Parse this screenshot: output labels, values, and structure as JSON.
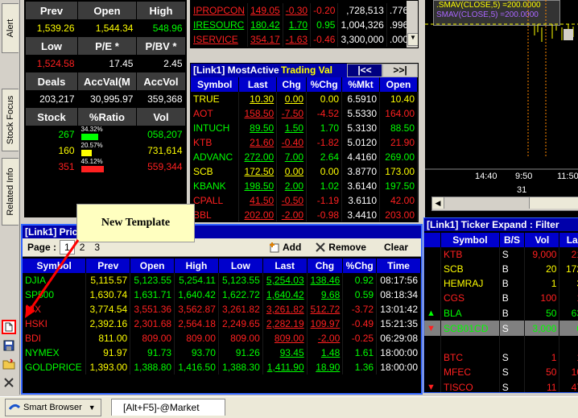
{
  "side_tabs": [
    "Alert",
    "Stock Focus",
    "Related Info"
  ],
  "side_icons": [
    "new-template-icon",
    "save-icon",
    "folder-icon",
    "close-icon"
  ],
  "stats": {
    "h1": [
      "Prev",
      "Open",
      "High"
    ],
    "r1": [
      "1,539.26",
      "1,544.34",
      "548.96"
    ],
    "h2": [
      "Low",
      "P/E *",
      "P/BV *"
    ],
    "r2": [
      "1,524.58",
      "17.45",
      "2.45"
    ],
    "h3": [
      "Deals",
      "AccVal(M",
      "AccVol"
    ],
    "r3": [
      "203,217",
      "30,995.97",
      "359,368"
    ],
    "h4": [
      "Stock",
      "%Ratio",
      "Vol"
    ],
    "ratio_rows": [
      {
        "stock": "267",
        "ratio": "34.32%",
        "pct": 0.3432,
        "vol": "058,207",
        "color": "#00ff00"
      },
      {
        "stock": "160",
        "ratio": "20.57%",
        "pct": 0.2057,
        "vol": "731,614",
        "color": "#ffff00"
      },
      {
        "stock": "351",
        "ratio": "45.12%",
        "pct": 0.4512,
        "vol": "559,344",
        "color": "#ff2020"
      }
    ]
  },
  "top_strip": [
    {
      "sym": "IPROPCON",
      "last": "149.05",
      "chg": "-0.30",
      "pct": "-0.20",
      "vol": ",728,513",
      "x": ".776"
    },
    {
      "sym": "IRESOURC",
      "last": "180.42",
      "chg": "1.70",
      "pct": "0.95",
      "vol": "1,004,326",
      "x": ".996"
    },
    {
      "sym": "ISERVICE",
      "last": "354.17",
      "chg": "-1.63",
      "pct": "-0.46",
      "vol": "3,300,000",
      "x": ".000"
    }
  ],
  "most_active": {
    "title": "[Link1] MostActive",
    "overlay": "Trading Val",
    "nav_prev": "|<<",
    "nav_next": ">>|",
    "headers": [
      "Symbol",
      "Last",
      "Chg",
      "%Chg",
      "%Mkt",
      "Open"
    ],
    "rows": [
      {
        "sym": "TRUE",
        "last": "10.30",
        "chg": "0.00",
        "pct": "0.00",
        "mkt": "6.5910",
        "open": "10.40",
        "c": "y"
      },
      {
        "sym": "AOT",
        "last": "158.50",
        "chg": "-7.50",
        "pct": "-4.52",
        "mkt": "5.5330",
        "open": "164.00",
        "c": "r"
      },
      {
        "sym": "INTUCH",
        "last": "89.50",
        "chg": "1.50",
        "pct": "1.70",
        "mkt": "5.3130",
        "open": "88.50",
        "c": "g"
      },
      {
        "sym": "KTB",
        "last": "21.60",
        "chg": "-0.40",
        "pct": "-1.82",
        "mkt": "5.0120",
        "open": "21.90",
        "c": "r"
      },
      {
        "sym": "ADVANC",
        "last": "272.00",
        "chg": "7.00",
        "pct": "2.64",
        "mkt": "4.4160",
        "open": "269.00",
        "c": "g"
      },
      {
        "sym": "SCB",
        "last": "172.50",
        "chg": "0.00",
        "pct": "0.00",
        "mkt": "3.8770",
        "open": "173.00",
        "c": "y"
      },
      {
        "sym": "KBANK",
        "last": "198.50",
        "chg": "2.00",
        "pct": "1.02",
        "mkt": "3.6140",
        "open": "197.50",
        "c": "g"
      },
      {
        "sym": "CPALL",
        "last": "41.50",
        "chg": "-0.50",
        "pct": "-1.19",
        "mkt": "3.6110",
        "open": "42.00",
        "c": "r"
      },
      {
        "sym": "BBL",
        "last": "202.00",
        "chg": "-2.00",
        "pct": "-0.98",
        "mkt": "3.4410",
        "open": "203.00",
        "c": "r"
      }
    ]
  },
  "chart": {
    "legend": [
      ".SMAV(CLOSE,5)",
      "=200.0000",
      "SMAV(CLOSE,5)",
      "=200.0000"
    ],
    "times": [
      "14:40",
      "9:50",
      "11:50"
    ],
    "day_label": "31"
  },
  "price_panel": {
    "title": "[Link1] Pric",
    "page_label": "Page :",
    "pages": [
      "1",
      "2",
      "3"
    ],
    "add_label": "Add",
    "remove_label": "Remove",
    "clear_label": "Clear",
    "headers": [
      "Symbol",
      "Prev",
      "Open",
      "High",
      "Low",
      "Last",
      "Chg",
      "%Chg",
      "Time"
    ],
    "rows": [
      {
        "sym": "DJIA",
        "prev": "5,115.57",
        "open": "5,123.55",
        "high": "5,254.11",
        "low": "5,123.55",
        "last": "5,254.03",
        "chg": "138.46",
        "pct": "0.92",
        "time": "08:17:56",
        "c": "g"
      },
      {
        "sym": "SP500",
        "prev": "1,630.74",
        "open": "1,631.71",
        "high": "1,640.42",
        "low": "1,622.72",
        "last": "1,640.42",
        "chg": "9.68",
        "pct": "0.59",
        "time": "08:18:34",
        "c": "g"
      },
      {
        "sym": "NIX",
        "prev": "3,774.54",
        "open": "3,551.36",
        "high": "3,562.87",
        "low": "3,261.82",
        "last": "3,261.82",
        "chg": "512.72",
        "pct": "-3.72",
        "time": "13:01:42",
        "c": "r"
      },
      {
        "sym": "HSKI",
        "prev": "2,392.16",
        "open": "2,301.68",
        "high": "2,564.18",
        "low": "2,249.65",
        "last": "2,282.19",
        "chg": "109.97",
        "pct": "-0.49",
        "time": "15:21:35",
        "c": "r"
      },
      {
        "sym": "BDI",
        "prev": "811.00",
        "open": "809.00",
        "high": "809.00",
        "low": "809.00",
        "last": "809.00",
        "chg": "-2.00",
        "pct": "-0.25",
        "time": "06:29:08",
        "c": "r"
      },
      {
        "sym": "NYMEX",
        "prev": "91.97",
        "open": "91.73",
        "high": "93.70",
        "low": "91.26",
        "last": "93.45",
        "chg": "1.48",
        "pct": "1.61",
        "time": "18:00:00",
        "c": "g"
      },
      {
        "sym": "GOLDPRICE",
        "prev": "1,393.00",
        "open": "1,388.80",
        "high": "1,416.50",
        "low": "1,388.30",
        "last": "1,411.90",
        "chg": "18.90",
        "pct": "1.36",
        "time": "18:00:00",
        "c": "g"
      }
    ]
  },
  "ticker": {
    "title": "[Link1] Ticker Expand : Filter",
    "headers": [
      "Symbol",
      "B/S",
      "Vol",
      "La"
    ],
    "rows": [
      {
        "sym": "KTB",
        "bs": "S",
        "vol": "9,000",
        "la": "21",
        "c": "r",
        "mark": ""
      },
      {
        "sym": "SCB",
        "bs": "B",
        "vol": "20",
        "la": "172",
        "c": "y",
        "mark": ""
      },
      {
        "sym": "HEMRAJ",
        "bs": "B",
        "vol": "1",
        "la": "3",
        "c": "y",
        "mark": ""
      },
      {
        "sym": "CGS",
        "bs": "B",
        "vol": "100",
        "la": "1",
        "c": "r",
        "mark": ""
      },
      {
        "sym": "BLA",
        "bs": "B",
        "vol": "50",
        "la": "63",
        "c": "g",
        "mark": "up"
      },
      {
        "sym": "SCB01CD",
        "bs": "S",
        "vol": "3,000",
        "la": "0",
        "c": "g",
        "mark": "down"
      },
      {
        "sym": "",
        "bs": "",
        "vol": "",
        "la": "",
        "c": "w",
        "mark": ""
      },
      {
        "sym": "BTC",
        "bs": "S",
        "vol": "1",
        "la": "1",
        "c": "r",
        "mark": ""
      },
      {
        "sym": "MFEC",
        "bs": "S",
        "vol": "50",
        "la": "10",
        "c": "r",
        "mark": ""
      },
      {
        "sym": "TISCO",
        "bs": "S",
        "vol": "11",
        "la": "47",
        "c": "r",
        "mark": "down"
      }
    ]
  },
  "callout": {
    "text": "New Template"
  },
  "taskbar": {
    "smart_browser": "Smart Browser",
    "tab": "[Alt+F5]-@Market"
  }
}
